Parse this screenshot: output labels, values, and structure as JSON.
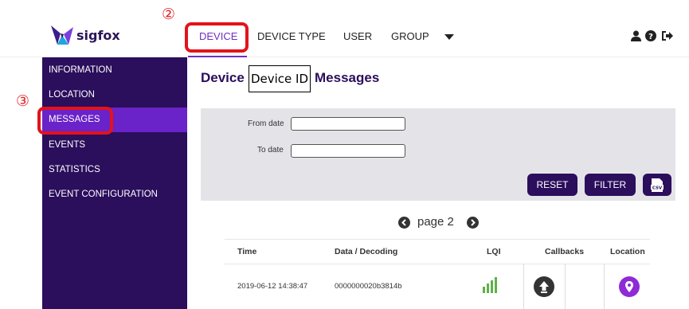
{
  "brand": {
    "name": "sigfox"
  },
  "annotations": {
    "nav": "②",
    "sidebar": "③"
  },
  "nav": {
    "items": [
      {
        "label": "DEVICE",
        "active": true
      },
      {
        "label": "DEVICE TYPE"
      },
      {
        "label": "USER"
      },
      {
        "label": "GROUP"
      }
    ],
    "more_icon": "caret-down-icon",
    "right_icons": [
      "user-icon",
      "help-icon",
      "logout-icon"
    ]
  },
  "sidebar": {
    "items": [
      {
        "label": "INFORMATION"
      },
      {
        "label": "LOCATION"
      },
      {
        "label": "MESSAGES",
        "active": true
      },
      {
        "label": "EVENTS"
      },
      {
        "label": "STATISTICS"
      },
      {
        "label": "EVENT CONFIGURATION"
      }
    ]
  },
  "page": {
    "title_prefix": "Device",
    "device_id": "Device ID",
    "title_suffix": "Messages"
  },
  "filter": {
    "from_label": "From date",
    "from_value": "",
    "to_label": "To date",
    "to_value": "",
    "reset_label": "RESET",
    "filter_label": "FILTER",
    "csv_label": "CSV"
  },
  "pager": {
    "text": "page 2"
  },
  "table": {
    "headers": [
      "Time",
      "Data / Decoding",
      "LQI",
      "Callbacks",
      "Location"
    ],
    "rows": [
      {
        "time": "2019-06-12 14:38:47",
        "data": "0000000020b3814b",
        "lqi_bars": 4,
        "lqi_max": 4
      }
    ]
  },
  "colors": {
    "brand_purple": "#2b0e5c",
    "active_purple": "#6a22c9",
    "accent": "#6f2fc2",
    "highlight_red": "#e3131b",
    "lqi_green": "#5cb247",
    "location_purple": "#8e2bd6"
  }
}
